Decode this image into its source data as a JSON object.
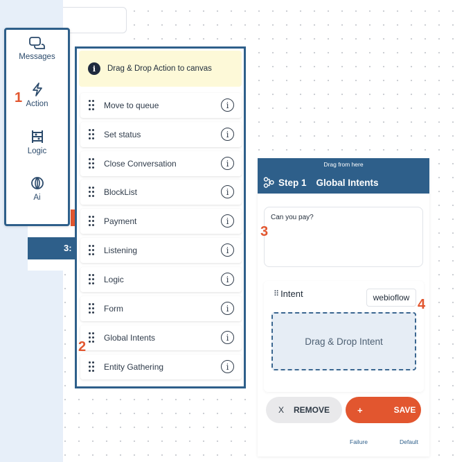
{
  "canvas": {
    "dot_color": "#c9ccd2"
  },
  "sidebar_menu": {
    "items": [
      {
        "label": "Messages",
        "icon": "messages-icon"
      },
      {
        "label": "Action",
        "icon": "lightning-icon"
      },
      {
        "label": "Logic",
        "icon": "logic-icon"
      },
      {
        "label": "Ai",
        "icon": "ai-brain-icon"
      }
    ],
    "border_color": "#2e5f8a"
  },
  "background_node": {
    "label": "3:"
  },
  "action_panel": {
    "hint": "Drag & Drop Action to canvas",
    "items": [
      {
        "label": "Move to queue"
      },
      {
        "label": "Set status"
      },
      {
        "label": "Close Conversation"
      },
      {
        "label": "BlockList"
      },
      {
        "label": "Payment"
      },
      {
        "label": "Listening"
      },
      {
        "label": "Logic"
      },
      {
        "label": "Form"
      },
      {
        "label": "Global Intents"
      },
      {
        "label": "Entity Gathering"
      }
    ]
  },
  "step_node": {
    "drag_hint": "Drag from here",
    "step_number": "Step 1",
    "step_name": "Global Intents",
    "question": "Can you pay?",
    "intent_label": "Intent",
    "intent_value": "webioflow",
    "drop_zone": "Drag & Drop Intent",
    "remove_icon": "X",
    "remove_label": "REMOVE",
    "save_icon": "+",
    "save_label": "SAVE",
    "ports": {
      "failure": "Failure",
      "default": "Default"
    },
    "header_color": "#2e5f8a",
    "accent_color": "#e2562f"
  },
  "annotations": [
    "1",
    "2",
    "3",
    "4"
  ]
}
